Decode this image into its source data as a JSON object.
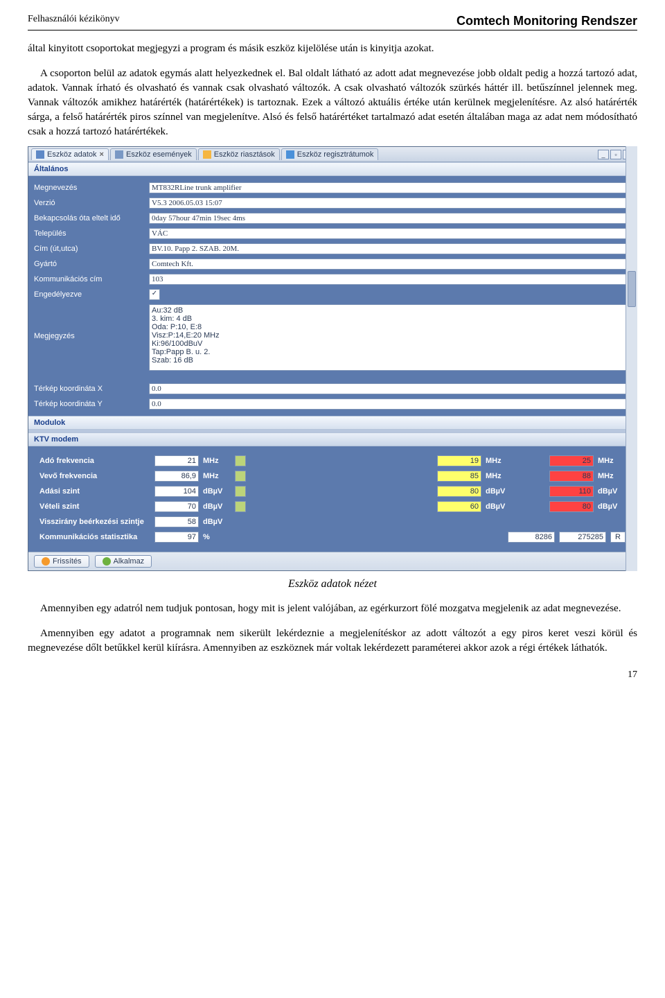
{
  "header": {
    "left": "Felhasználói kézikönyv",
    "right": "Comtech Monitoring Rendszer"
  },
  "para1": "által kinyitott csoportokat megjegyzi a program és másik eszköz kijelölése után is kinyitja azokat.",
  "para2": "A csoporton belül az adatok egymás alatt helyezkednek el. Bal oldalt látható az adott adat megnevezése jobb oldalt pedig a hozzá tartozó adat, adatok. Vannak írható és olvasható és vannak csak olvasható változók. A csak olvasható változók szürkés háttér ill. betűszínnel jelennek meg. Vannak változók amikhez határérték (határértékek) is tartoznak. Ezek a változó aktuális értéke után kerülnek megjelenítésre. Az alsó határérték sárga, a felső határérték piros színnel van megjelenítve. Alsó és felső határértéket tartalmazó adat esetén általában maga az adat nem módosítható csak a hozzá tartozó határértékek.",
  "tabs": [
    {
      "label": "Eszköz adatok",
      "active": true
    },
    {
      "label": "Eszköz események"
    },
    {
      "label": "Eszköz riasztások"
    },
    {
      "label": "Eszköz regisztrátumok"
    }
  ],
  "sections": {
    "general": "Általános",
    "modulok": "Modulok",
    "ktv": "KTV modem"
  },
  "general": {
    "megnevezes": {
      "label": "Megnevezés",
      "value": "MT832RLine trunk amplifier"
    },
    "verzio": {
      "label": "Verzió",
      "value": "V5.3 2006.05.03 15:07"
    },
    "uptime": {
      "label": "Bekapcsolás óta eltelt idő",
      "value": "0day 57hour 47min 19sec 4ms"
    },
    "telepules": {
      "label": "Település",
      "value": "VÁC"
    },
    "cim": {
      "label": "Cím (út,utca)",
      "value": "BV.10. Papp 2. SZAB. 20M."
    },
    "gyarto": {
      "label": "Gyártó",
      "value": "Comtech Kft."
    },
    "komm": {
      "label": "Kommunikációs cím",
      "value": "103"
    },
    "eng": {
      "label": "Engedélyezve",
      "checked": "✓"
    },
    "megj": {
      "label": "Megjegyzés",
      "value": "Au:32 dB\n3. kim: 4 dB\nOda: P:10, E:8\nVisz:P:14,E:20 MHz\nKi:96/100dBuV\nTap:Papp B. u. 2.\nSzab: 16 dB"
    },
    "tx": {
      "label": "Térkép koordináta X",
      "value": "0.0"
    },
    "ty": {
      "label": "Térkép koordináta Y",
      "value": "0.0"
    }
  },
  "ktv": {
    "adofr": {
      "label": "Adó frekvencia",
      "v": "21",
      "lo": "19",
      "hi": "25",
      "unit": "MHz"
    },
    "vevofr": {
      "label": "Vevő frekvencia",
      "v": "86,9",
      "lo": "85",
      "hi": "88",
      "unit": "MHz"
    },
    "adasi": {
      "label": "Adási szint",
      "v": "104",
      "lo": "80",
      "hi": "110",
      "unit": "dBµV"
    },
    "veteli": {
      "label": "Vételi szint",
      "v": "70",
      "lo": "60",
      "hi": "80",
      "unit": "dBµV"
    },
    "vissz": {
      "label": "Visszirány beérkezési szintje",
      "v": "58",
      "unit": "dBµV"
    },
    "komm": {
      "label": "Kommunikációs statisztika",
      "v": "97",
      "lo": "8286",
      "hi": "275285",
      "unit": "%",
      "reset": "R"
    }
  },
  "buttons": {
    "refresh": "Frissítés",
    "apply": "Alkalmaz"
  },
  "caption": "Eszköz adatok nézet",
  "para3": "Amennyiben egy adatról nem tudjuk pontosan, hogy mit is jelent valójában, az egérkurzort fölé mozgatva megjelenik az adat megnevezése.",
  "para4": "Amennyiben egy adatot a programnak nem sikerült lekérdeznie a megjelenítéskor az adott változót a egy piros keret veszi körül és megnevezése dőlt betűkkel kerül kiírásra. Amennyiben az eszköznek már voltak lekérdezett paraméterei akkor azok a régi értékek láthatók.",
  "pagenum": "17"
}
